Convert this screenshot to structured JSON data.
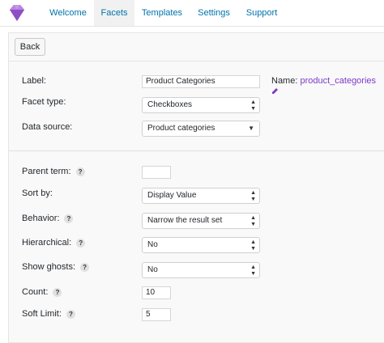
{
  "nav": {
    "tabs": [
      {
        "label": "Welcome"
      },
      {
        "label": "Facets"
      },
      {
        "label": "Templates"
      },
      {
        "label": "Settings"
      },
      {
        "label": "Support"
      }
    ],
    "active": "Facets",
    "logo_icon": "gem-icon",
    "logo_color": "#a66bd3"
  },
  "toolbar": {
    "back_label": "Back"
  },
  "form": {
    "label": {
      "text": "Label:",
      "value": "Product Categories"
    },
    "name": {
      "text": "Name:",
      "value": "product_categories",
      "icon": "pencil-icon"
    },
    "facet_type": {
      "text": "Facet type:",
      "value": "Checkboxes"
    },
    "data_source": {
      "text": "Data source:",
      "value": "Product categories"
    },
    "parent_term": {
      "text": "Parent term:",
      "value": ""
    },
    "sort_by": {
      "text": "Sort by:",
      "value": "Display Value"
    },
    "behavior": {
      "text": "Behavior:",
      "value": "Narrow the result set"
    },
    "hierarchical": {
      "text": "Hierarchical:",
      "value": "No"
    },
    "show_ghosts": {
      "text": "Show ghosts:",
      "value": "No"
    },
    "count": {
      "text": "Count:",
      "value": "10"
    },
    "soft_limit": {
      "text": "Soft Limit:",
      "value": "5"
    },
    "help_glyph": "?"
  },
  "colors": {
    "link": "#0073aa",
    "accent": "#7c3ac9"
  }
}
